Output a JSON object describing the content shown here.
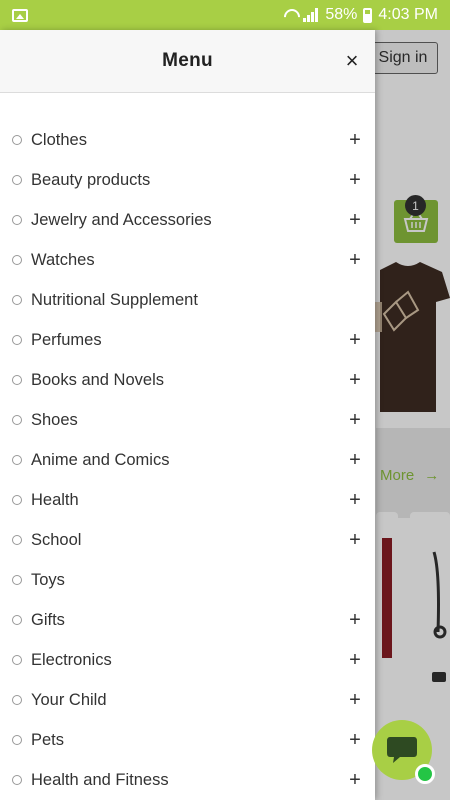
{
  "status_bar": {
    "battery_percent": "58%",
    "time": "4:03 PM",
    "background_color": "#a8cf45"
  },
  "background_page": {
    "sign_in_label": "Sign in",
    "cart_count": "1",
    "more_label": "More",
    "more_arrow": "→",
    "accent_color": "#8dbe3f"
  },
  "drawer": {
    "title": "Menu",
    "close_glyph": "×",
    "items": [
      {
        "label": "Clothes",
        "expandable": true
      },
      {
        "label": "Beauty products",
        "expandable": true
      },
      {
        "label": "Jewelry and Accessories",
        "expandable": true
      },
      {
        "label": "Watches",
        "expandable": true
      },
      {
        "label": "Nutritional Supplement",
        "expandable": false
      },
      {
        "label": "Perfumes",
        "expandable": true
      },
      {
        "label": "Books and Novels",
        "expandable": true
      },
      {
        "label": "Shoes",
        "expandable": true
      },
      {
        "label": "Anime and Comics",
        "expandable": true
      },
      {
        "label": "Health",
        "expandable": true
      },
      {
        "label": "School",
        "expandable": true
      },
      {
        "label": "Toys",
        "expandable": false
      },
      {
        "label": "Gifts",
        "expandable": true
      },
      {
        "label": "Electronics",
        "expandable": true
      },
      {
        "label": "Your Child",
        "expandable": true
      },
      {
        "label": "Pets",
        "expandable": true
      },
      {
        "label": "Health and Fitness",
        "expandable": true
      }
    ],
    "expand_glyph": "+"
  }
}
